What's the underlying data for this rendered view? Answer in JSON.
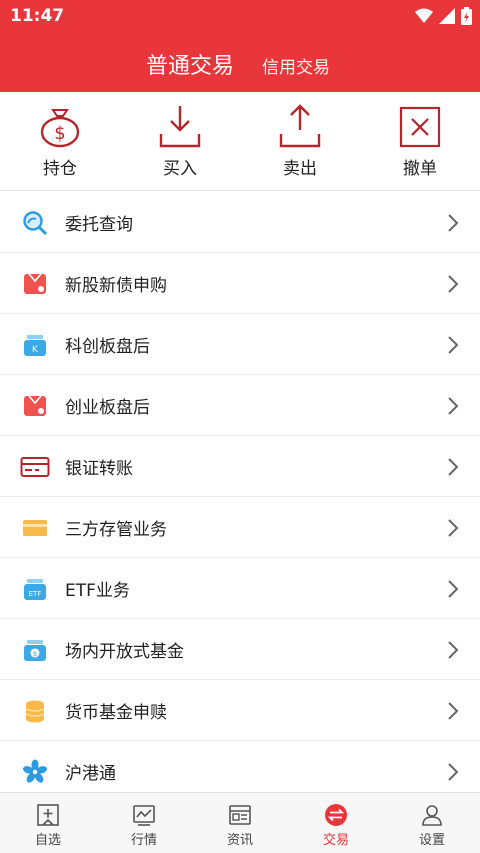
{
  "status": {
    "time": "11:47"
  },
  "header": {
    "active_tab": "普通交易",
    "other_tab": "信用交易"
  },
  "actions": [
    {
      "label": "持仓",
      "icon": "money-bag-icon"
    },
    {
      "label": "买入",
      "icon": "download-icon"
    },
    {
      "label": "卖出",
      "icon": "upload-icon"
    },
    {
      "label": "撤单",
      "icon": "cancel-icon"
    }
  ],
  "menu": [
    {
      "label": "委托查询",
      "icon": "search-icon"
    },
    {
      "label": "新股新债申购",
      "icon": "red-card-icon"
    },
    {
      "label": "科创板盘后",
      "icon": "kcb-icon"
    },
    {
      "label": "创业板盘后",
      "icon": "red-card-icon"
    },
    {
      "label": "银证转账",
      "icon": "card-icon"
    },
    {
      "label": "三方存管业务",
      "icon": "yellow-card-icon"
    },
    {
      "label": "ETF业务",
      "icon": "etf-icon"
    },
    {
      "label": "场内开放式基金",
      "icon": "fund-icon"
    },
    {
      "label": "货币基金申赎",
      "icon": "coins-icon"
    },
    {
      "label": "沪港通",
      "icon": "flower-icon"
    }
  ],
  "nav": [
    {
      "label": "自选",
      "icon": "favorites-icon"
    },
    {
      "label": "行情",
      "icon": "chart-icon"
    },
    {
      "label": "资讯",
      "icon": "news-icon"
    },
    {
      "label": "交易",
      "icon": "trade-icon"
    },
    {
      "label": "设置",
      "icon": "user-icon"
    }
  ],
  "colors": {
    "primary": "#e8363a"
  }
}
